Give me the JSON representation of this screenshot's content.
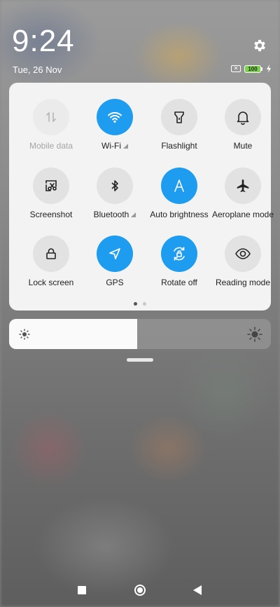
{
  "status": {
    "time": "9:24",
    "date": "Tue, 26 Nov",
    "battery_level": "100",
    "sim_icon": "sim-off-icon"
  },
  "tiles": [
    {
      "label": "Mobile data",
      "icon": "mobile-data-icon",
      "state": "disabled",
      "arrow": false
    },
    {
      "label": "Wi-Fi",
      "icon": "wifi-icon",
      "state": "on",
      "arrow": true
    },
    {
      "label": "Flashlight",
      "icon": "flashlight-icon",
      "state": "off",
      "arrow": false
    },
    {
      "label": "Mute",
      "icon": "bell-icon",
      "state": "off",
      "arrow": false
    },
    {
      "label": "Screenshot",
      "icon": "screenshot-icon",
      "state": "off",
      "arrow": false
    },
    {
      "label": "Bluetooth",
      "icon": "bluetooth-icon",
      "state": "off",
      "arrow": true
    },
    {
      "label": "Auto brightness",
      "icon": "auto-brightness-icon",
      "state": "on",
      "arrow": false
    },
    {
      "label": "Aeroplane mode",
      "icon": "aeroplane-icon",
      "state": "off",
      "arrow": false
    },
    {
      "label": "Lock screen",
      "icon": "lock-icon",
      "state": "off",
      "arrow": false
    },
    {
      "label": "GPS",
      "icon": "gps-icon",
      "state": "on",
      "arrow": false
    },
    {
      "label": "Rotate off",
      "icon": "rotate-lock-icon",
      "state": "on",
      "arrow": false
    },
    {
      "label": "Reading mode",
      "icon": "eye-icon",
      "state": "off",
      "arrow": false
    }
  ],
  "pager": {
    "pages": 2,
    "current": 1
  },
  "brightness": {
    "level": 0.49
  },
  "colors": {
    "accent": "#1e9cf0",
    "tile_off": "#e2e2e2",
    "panel": "#f3f3f3"
  }
}
